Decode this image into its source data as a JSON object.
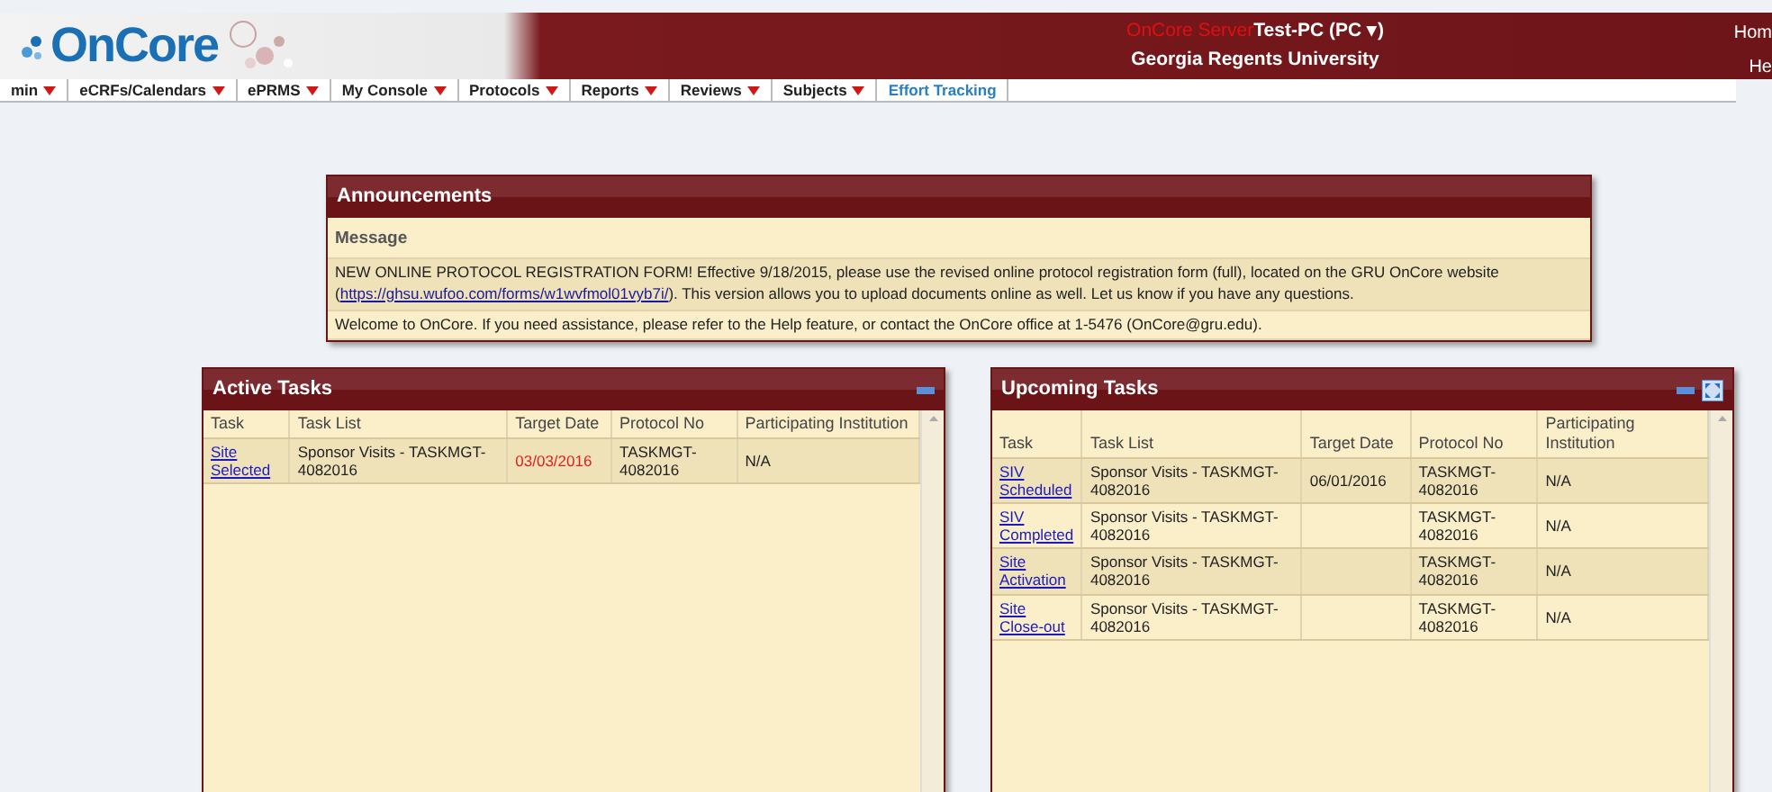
{
  "header": {
    "logo": "OnCore",
    "server_label": "OnCore Server",
    "server_value": "Test-PC (PC ▾)",
    "institution": "Georgia Regents University",
    "links": [
      "Hom",
      "He"
    ]
  },
  "nav": [
    {
      "label": "min",
      "menu": true,
      "selected": false
    },
    {
      "label": "eCRFs/Calendars",
      "menu": true,
      "selected": false
    },
    {
      "label": "ePRMS",
      "menu": true,
      "selected": false
    },
    {
      "label": "My Console",
      "menu": true,
      "selected": false
    },
    {
      "label": "Protocols",
      "menu": true,
      "selected": false
    },
    {
      "label": "Reports",
      "menu": true,
      "selected": false
    },
    {
      "label": "Reviews",
      "menu": true,
      "selected": false
    },
    {
      "label": "Subjects",
      "menu": true,
      "selected": false
    },
    {
      "label": "Effort Tracking",
      "menu": false,
      "selected": true
    }
  ],
  "announcements": {
    "title": "Announcements",
    "column": "Message",
    "messages": [
      {
        "parts": [
          "NEW ONLINE PROTOCOL REGISTRATION FORM! Effective 9/18/2015, please use the revised online protocol registration form (full), located on the GRU OnCore website (",
          "https://ghsu.wufoo.com/forms/w1wvfmol01vyb7i/",
          "). This version allows you to upload documents online as well. Let us know if you have any questions."
        ]
      },
      {
        "parts": [
          "Welcome to OnCore. If you need assistance, please refer to the Help feature, or contact the OnCore office at 1-5476 (OnCore@gru.edu)."
        ]
      }
    ]
  },
  "panels": [
    {
      "title": "Active Tasks",
      "maximize": false,
      "columns": [
        "Task",
        "Task List",
        "Target Date",
        "Protocol No",
        "Participating Institution"
      ],
      "rows": [
        {
          "task": "Site Selected",
          "task_list": "Sponsor Visits - TASKMGT-4082016",
          "target_date": "03/03/2016",
          "overdue": true,
          "protocol_no": "TASKMGT-4082016",
          "institution": "N/A"
        }
      ]
    },
    {
      "title": "Upcoming Tasks",
      "maximize": true,
      "columns": [
        "Task",
        "Task List",
        "Target Date",
        "Protocol No",
        "Participating Institution"
      ],
      "rows": [
        {
          "task": "SIV Scheduled",
          "task_list": "Sponsor Visits - TASKMGT-4082016",
          "target_date": "06/01/2016",
          "overdue": false,
          "protocol_no": "TASKMGT-4082016",
          "institution": "N/A"
        },
        {
          "task": "SIV Completed",
          "task_list": "Sponsor Visits - TASKMGT-4082016",
          "protocol_no": "TASKMGT-4082016",
          "institution": "N/A"
        },
        {
          "task": "Site Activation",
          "task_list": "Sponsor Visits - TASKMGT-4082016",
          "protocol_no": "TASKMGT-4082016",
          "institution": "N/A"
        },
        {
          "task": "Site Close-out",
          "task_list": "Sponsor Visits - TASKMGT-4082016",
          "protocol_no": "TASKMGT-4082016",
          "institution": "N/A"
        }
      ]
    }
  ]
}
